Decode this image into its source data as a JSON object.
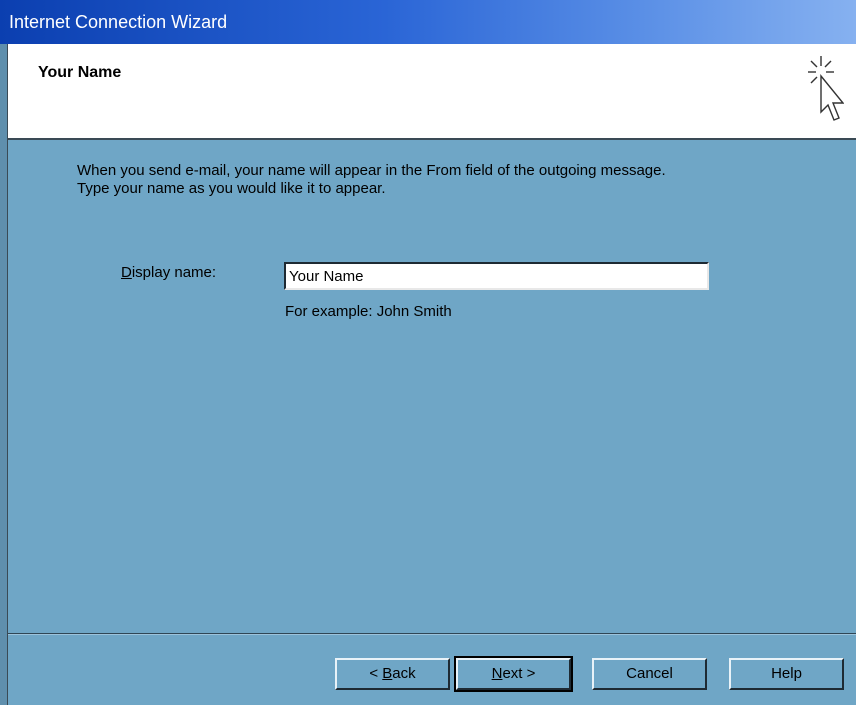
{
  "window": {
    "title": "Internet Connection Wizard"
  },
  "header": {
    "title": "Your Name",
    "icon": "wizard-cursor-icon"
  },
  "body": {
    "description_line1": "When you send e-mail, your name will appear in the From field of the outgoing message.",
    "description_line2": "Type your name as you would like it to appear.",
    "display_name_label_accel": "D",
    "display_name_label_rest": "isplay name:",
    "display_name_value": "Your Name",
    "example_text": "For example: John Smith"
  },
  "buttons": {
    "back_prefix": "< ",
    "back_accel": "B",
    "back_rest": "ack",
    "next_accel": "N",
    "next_rest": "ext >",
    "cancel": "Cancel",
    "help": "Help"
  },
  "colors": {
    "dialog_bg": "#6fa6c6",
    "titlebar": "#0b3fb0",
    "header_bg": "#ffffff"
  }
}
